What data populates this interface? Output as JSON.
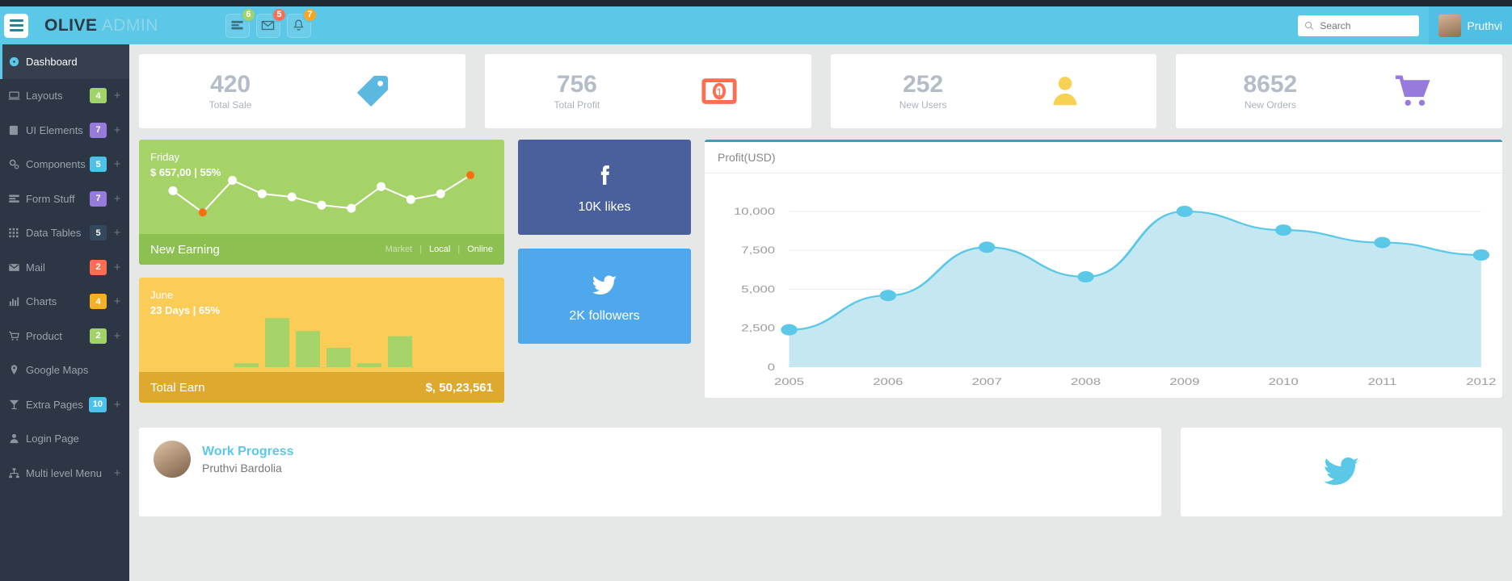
{
  "header": {
    "brand_main": "OLIVE",
    "brand_sub": "ADMIN",
    "menu_icon": "hamburger-icon",
    "buttons": [
      {
        "icon": "list-icon",
        "badge": "6",
        "color": "#a0d468"
      },
      {
        "icon": "envelope-icon",
        "badge": "5",
        "color": "#fc6e51"
      },
      {
        "icon": "bell-icon",
        "badge": "7",
        "color": "#f6a623"
      }
    ],
    "search_placeholder": "Search",
    "search_value": "",
    "user_name": "Pruthvi"
  },
  "sidebar": {
    "items": [
      {
        "label": "Dashboard",
        "icon": "dashboard-icon",
        "badge": null,
        "badge_class": "",
        "plus": false,
        "active": true
      },
      {
        "label": "Layouts",
        "icon": "laptop-icon",
        "badge": "4",
        "badge_class": "g-green",
        "plus": true,
        "active": false
      },
      {
        "label": "UI Elements",
        "icon": "book-icon",
        "badge": "7",
        "badge_class": "g-purple",
        "plus": true,
        "active": false
      },
      {
        "label": "Components",
        "icon": "gears-icon",
        "badge": "5",
        "badge_class": "g-blue",
        "plus": true,
        "active": false
      },
      {
        "label": "Form Stuff",
        "icon": "form-icon",
        "badge": "7",
        "badge_class": "g-purple",
        "plus": true,
        "active": false
      },
      {
        "label": "Data Tables",
        "icon": "grid-icon",
        "badge": "5",
        "badge_class": "g-dark",
        "plus": true,
        "active": false
      },
      {
        "label": "Mail",
        "icon": "envelope-icon",
        "badge": "2",
        "badge_class": "g-red",
        "plus": true,
        "active": false
      },
      {
        "label": "Charts",
        "icon": "bar-chart-icon",
        "badge": "4",
        "badge_class": "g-orange",
        "plus": true,
        "active": false
      },
      {
        "label": "Product",
        "icon": "cart-icon",
        "badge": "2",
        "badge_class": "g-green",
        "plus": true,
        "active": false
      },
      {
        "label": "Google Maps",
        "icon": "map-pin-icon",
        "badge": null,
        "badge_class": "",
        "plus": false,
        "active": false
      },
      {
        "label": "Extra Pages",
        "icon": "martini-icon",
        "badge": "10",
        "badge_class": "g-blue",
        "plus": true,
        "active": false
      },
      {
        "label": "Login Page",
        "icon": "user-icon",
        "badge": null,
        "badge_class": "",
        "plus": false,
        "active": false
      },
      {
        "label": "Multi level Menu",
        "icon": "sitemap-icon",
        "badge": null,
        "badge_class": "",
        "plus": true,
        "active": false
      }
    ]
  },
  "stats": [
    {
      "value": "420",
      "label": "Total Sale",
      "icon": "tag-icon",
      "color": "#5bb9e0"
    },
    {
      "value": "756",
      "label": "Total Profit",
      "icon": "banknote-icon",
      "color": "#fc6e51"
    },
    {
      "value": "252",
      "label": "New Users",
      "icon": "person-icon",
      "color": "#f7d154"
    },
    {
      "value": "8652",
      "label": "New Orders",
      "icon": "cart-icon",
      "color": "#967adc"
    }
  ],
  "earning_card": {
    "day": "Friday",
    "value": "$ 657,00 | 55%",
    "title": "New Earning",
    "links": [
      "Market",
      "Local",
      "Online"
    ],
    "separator": "|"
  },
  "total_earn_card": {
    "month": "June",
    "value": "23 Days | 65%",
    "title": "Total Earn",
    "amount": "$, 50,23,561"
  },
  "social": [
    {
      "network": "facebook",
      "icon": "facebook-icon",
      "label": "10K likes",
      "color": "#4a609d"
    },
    {
      "network": "twitter",
      "icon": "twitter-icon",
      "label": "2K followers",
      "color": "#4fa8ec"
    }
  ],
  "work_progress": {
    "title": "Work Progress",
    "name": "Pruthvi Bardolia",
    "avatar": "user-avatar"
  },
  "twitter_panel": {
    "icon": "twitter-icon"
  },
  "chart_data": {
    "type": "area",
    "title": "Profit(USD)",
    "xlabel": "",
    "ylabel": "",
    "x": [
      "2005",
      "2006",
      "2007",
      "2008",
      "2009",
      "2010",
      "2011",
      "2012"
    ],
    "values": [
      2400,
      4600,
      7700,
      5800,
      10000,
      8800,
      8000,
      7200
    ],
    "yticks": [
      "0",
      "2,500",
      "5,000",
      "7,500",
      "10,000"
    ],
    "ylim": [
      0,
      11500
    ],
    "grid": true,
    "line_color": "#5bc8e8",
    "fill_color": "#c5e7f2",
    "point_color": "#5bc8e8"
  },
  "sparkline_green": {
    "type": "line",
    "values": [
      62,
      20,
      82,
      56,
      50,
      34,
      28,
      70,
      45,
      56,
      92
    ],
    "line_color": "#ffffff",
    "point_color": "#ffffff",
    "highlight_indices": [
      1,
      10
    ],
    "highlight_color": "#f96e11"
  },
  "bar_mini_yellow": {
    "type": "bar",
    "values": [
      6,
      76,
      56,
      30,
      6,
      48
    ],
    "bar_color": "#a5d368"
  }
}
